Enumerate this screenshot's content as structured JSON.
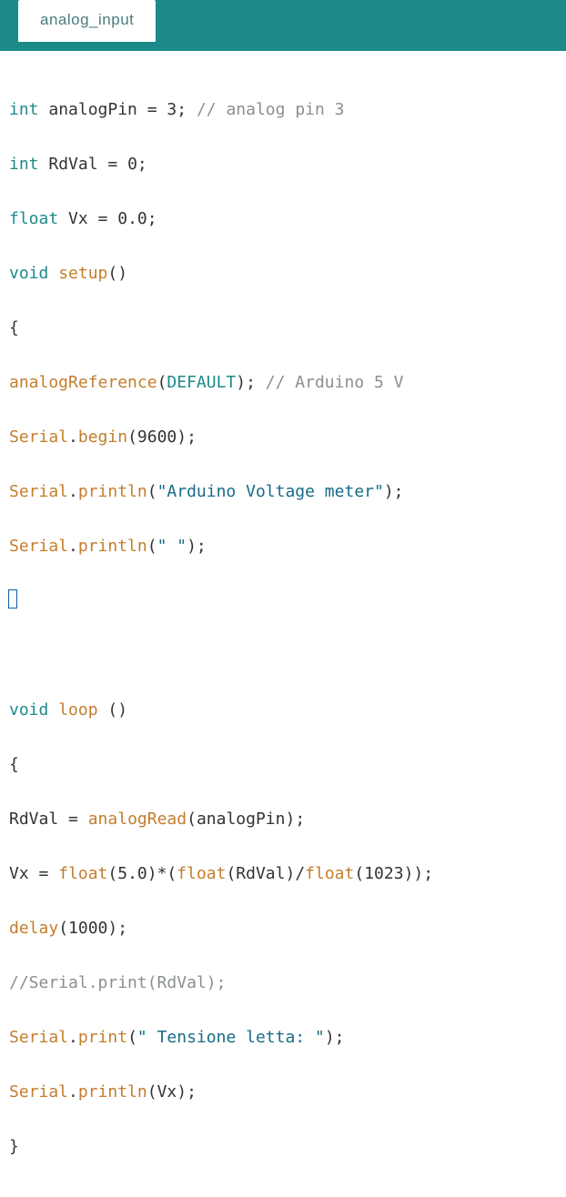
{
  "tab": {
    "label": "analog_input"
  },
  "code": {
    "kw_int1": "int",
    "id_analogPin": " analogPin ",
    "eq1": "= ",
    "num_3": "3",
    "semi1": "; ",
    "cmt1": "// analog pin 3",
    "kw_int2": "int",
    "id_RdVal": " RdVal ",
    "eq2": "= ",
    "num_0": "0",
    "semi2": ";",
    "kw_float1": "float",
    "id_Vx": " Vx ",
    "eq3": "= ",
    "num_00": "0.0",
    "semi3": ";",
    "kw_void1": "void",
    "sp1": " ",
    "fn_setup": "setup",
    "paren1": "()",
    "brace_open1": "{",
    "fn_analogReference": "analogReference",
    "lp1": "(",
    "const_default": "DEFAULT",
    "rp1": "); ",
    "cmt2": "// Arduino 5 V",
    "obj_serial1": "Serial",
    "dot1": ".",
    "fn_begin": "begin",
    "lp2": "(",
    "num_9600": "9600",
    "rp2": ");",
    "obj_serial2": "Serial",
    "dot2": ".",
    "fn_println1": "println",
    "lp3": "(",
    "str1": "\"Arduino Voltage meter\"",
    "rp3": ");",
    "obj_serial3": "Serial",
    "dot3": ".",
    "fn_println2": "println",
    "lp4": "(",
    "str2": "\" \"",
    "rp4": ");",
    "kw_void2": "void",
    "sp2": " ",
    "fn_loop": "loop",
    "sp3": " ",
    "paren2": "()",
    "brace_open2": "{",
    "id_RdVal2": "RdVal ",
    "eq4": "= ",
    "fn_analogRead": "analogRead",
    "lp5": "(",
    "arg_analogPin": "analogPin",
    "rp5": ");",
    "id_Vx2": "Vx ",
    "eq5": "= ",
    "fn_float1": "float",
    "lp6": "(",
    "num_5": "5.0",
    "rp6": ")*(",
    "fn_float2": "float",
    "lp7": "(",
    "arg_RdVal": "RdVal",
    "rp7": ")/",
    "fn_float3": "float",
    "lp8": "(",
    "num_1023": "1023",
    "rp8": "));",
    "fn_delay": "delay",
    "lp9": "(",
    "num_1000": "1000",
    "rp9": ");",
    "cmt3": "//Serial.print(RdVal);",
    "obj_serial4": "Serial",
    "dot4": ".",
    "fn_print": "print",
    "lp10": "(",
    "str3": "\" Tensione letta: \"",
    "rp10": ");",
    "obj_serial5": "Serial",
    "dot5": ".",
    "fn_println3": "println",
    "lp11": "(",
    "arg_Vx": "Vx",
    "rp11": ");",
    "brace_close2": "}"
  }
}
